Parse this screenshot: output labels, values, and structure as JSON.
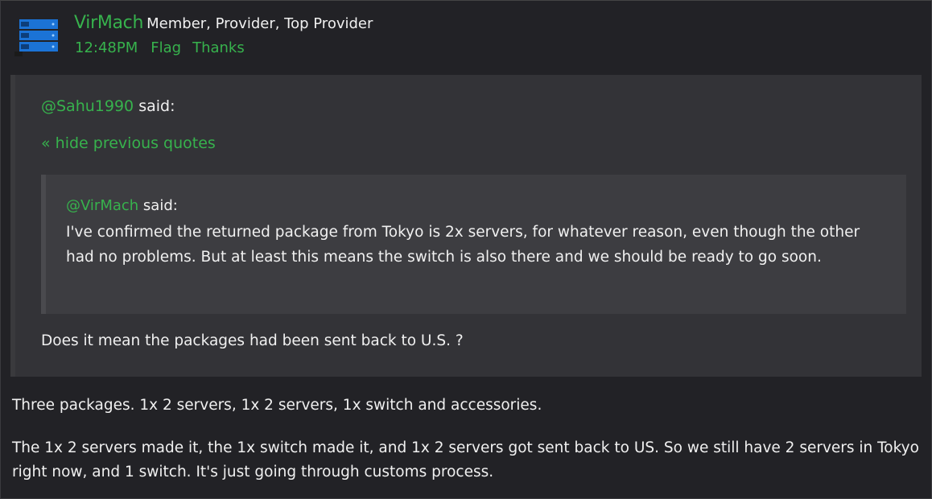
{
  "post": {
    "username": "VirMach",
    "roles": "Member, Provider, Top Provider",
    "time": "12:48PM",
    "flag_label": "Flag",
    "thanks_label": "Thanks"
  },
  "quote": {
    "author": "@Sahu1990",
    "said": "said:",
    "hide_link": "« hide previous quotes",
    "inner": {
      "author": "@VirMach",
      "said": "said:",
      "text": "I've confirmed the returned package from Tokyo is 2x servers, for whatever reason, even though the other had no problems. But at least this means the switch is also there and we should be ready to go soon."
    },
    "text": "Does it mean the packages had been sent back to U.S. ?"
  },
  "body": {
    "paragraphs": [
      "Three packages. 1x 2 servers, 1x 2 servers, 1x switch and accessories.",
      "The 1x 2 servers made it, the 1x switch made it, and 1x 2 servers got sent back to US. So we still have 2 servers in Tokyo right now, and 1 switch. It's just going through customs process."
    ]
  },
  "colors": {
    "accent": "#37b24d",
    "background": "#222226",
    "quote_bg": "#333337",
    "inner_quote_bg": "#3d3d41"
  },
  "icons": {
    "avatar": "server-rack-icon"
  }
}
